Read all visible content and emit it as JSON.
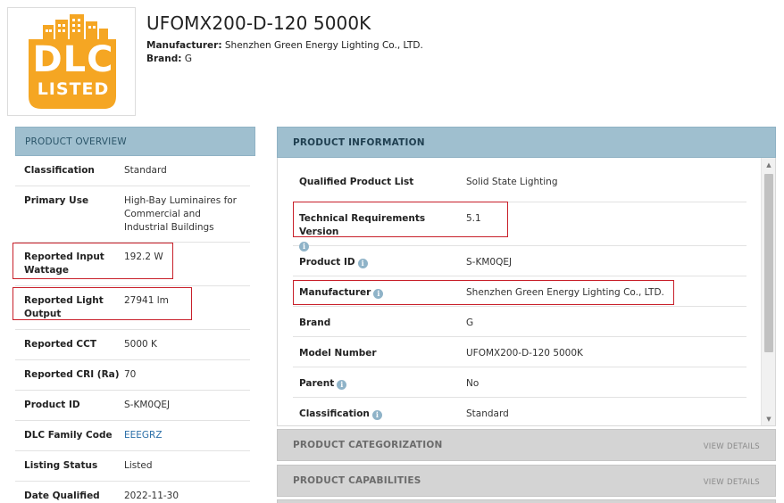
{
  "header": {
    "title": "UFOMX200-D-120 5000K",
    "manufacturer_label": "Manufacturer:",
    "manufacturer_value": "Shenzhen Green Energy Lighting Co., LTD.",
    "brand_label": "Brand:",
    "brand_value": "G"
  },
  "logo": {
    "line1": "DLC",
    "line2": "LISTED",
    "color": "#f5a623"
  },
  "overview": {
    "heading": "PRODUCT OVERVIEW",
    "rows": [
      {
        "label": "Classification",
        "value": "Standard"
      },
      {
        "label": "Primary Use",
        "value": "High-Bay Luminaires for Commercial and Industrial Buildings"
      },
      {
        "label": "Reported Input Wattage",
        "value": "192.2 W"
      },
      {
        "label": "Reported Light Output",
        "value": "27941 lm"
      },
      {
        "label": "Reported CCT",
        "value": "5000 K"
      },
      {
        "label": "Reported CRI (Ra)",
        "value": "70"
      },
      {
        "label": "Product ID",
        "value": "S-KM0QEJ"
      },
      {
        "label": "DLC Family Code",
        "value": "EEEGRZ"
      },
      {
        "label": "Listing Status",
        "value": "Listed"
      },
      {
        "label": "Date Qualified",
        "value": "2022-11-30"
      }
    ]
  },
  "information": {
    "heading": "PRODUCT INFORMATION",
    "rows": [
      {
        "label": "Qualified Product List",
        "value": "Solid State Lighting"
      },
      {
        "label": "Technical Requirements Version",
        "value": "5.1"
      },
      {
        "label": "Product ID",
        "value": "S-KM0QEJ"
      },
      {
        "label": "Manufacturer",
        "value": "Shenzhen Green Energy Lighting Co., LTD."
      },
      {
        "label": "Brand",
        "value": "G"
      },
      {
        "label": "Model Number",
        "value": "UFOMX200-D-120 5000K"
      },
      {
        "label": "Parent",
        "value": "No"
      },
      {
        "label": "Classification",
        "value": "Standard"
      }
    ]
  },
  "sections": [
    {
      "title": "PRODUCT CATEGORIZATION",
      "action": "VIEW DETAILS"
    },
    {
      "title": "PRODUCT CAPABILITIES",
      "action": "VIEW DETAILS"
    }
  ],
  "icons": {
    "info": "i"
  },
  "colors": {
    "panel_header": "#9fbfcf",
    "highlight": "#c8202a",
    "link": "#2b6fa8"
  }
}
